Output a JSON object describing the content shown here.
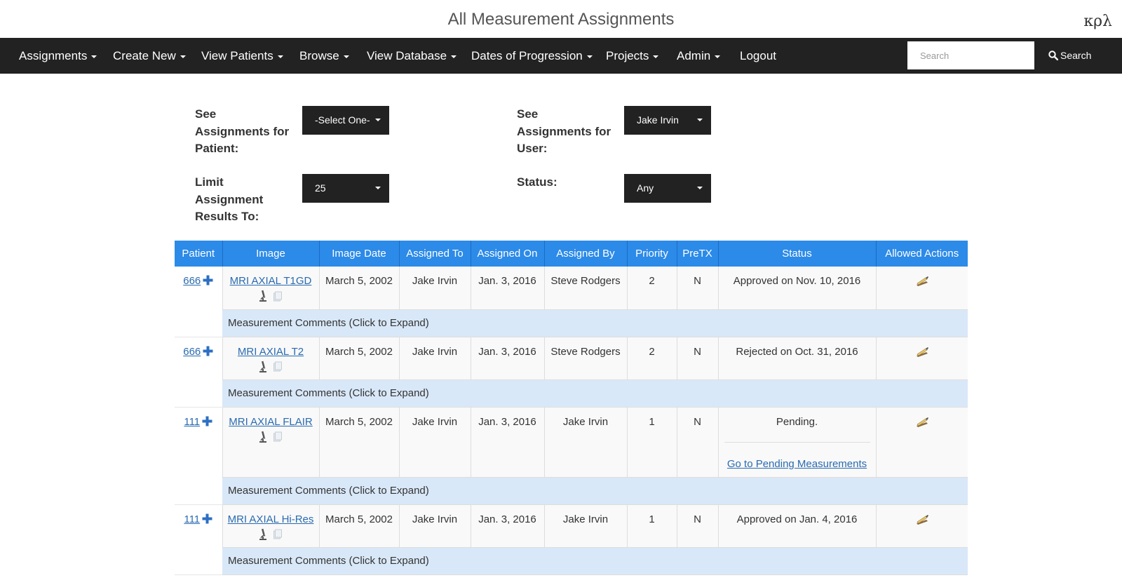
{
  "header": {
    "title": "All Measurement Assignments",
    "brand": "κρλ"
  },
  "nav": {
    "items": [
      {
        "label": "Assignments",
        "dropdown": true
      },
      {
        "label": "Create New",
        "dropdown": true
      },
      {
        "label": "View Patients",
        "dropdown": true
      },
      {
        "label": "Browse",
        "dropdown": true
      },
      {
        "label": "View Database",
        "dropdown": true
      },
      {
        "label": "Dates of Progression",
        "dropdown": true
      },
      {
        "label": "Projects",
        "dropdown": true
      },
      {
        "label": "Admin",
        "dropdown": true
      },
      {
        "label": "Logout",
        "dropdown": false
      }
    ],
    "search_placeholder": "Search",
    "search_button": "Search"
  },
  "filters": {
    "patient_label": [
      "See",
      "Assignments for",
      "Patient:"
    ],
    "patient_value": "-Select One-",
    "user_label": [
      "See",
      "Assignments for",
      "User:"
    ],
    "user_value": "Jake Irvin",
    "limit_label": [
      "Limit",
      "Assignment",
      "Results To:"
    ],
    "limit_value": "25",
    "status_label": "Status:",
    "status_value": "Any"
  },
  "table": {
    "columns": [
      "Patient",
      "Image",
      "Image Date",
      "Assigned To",
      "Assigned On",
      "Assigned By",
      "Priority",
      "PreTX",
      "Status",
      "Allowed Actions"
    ],
    "comments_label": "Measurement Comments (Click to Expand)",
    "rows": [
      {
        "patient": "666",
        "image": "MRI AXIAL T1GD",
        "image_date": "March 5, 2002",
        "assigned_to": "Jake Irvin",
        "assigned_on": "Jan. 3, 2016",
        "assigned_by": "Steve Rodgers",
        "priority": "2",
        "pretx": "N",
        "status": "Approved on Nov. 10, 2016"
      },
      {
        "patient": "666",
        "image": "MRI AXIAL T2",
        "image_date": "March 5, 2002",
        "assigned_to": "Jake Irvin",
        "assigned_on": "Jan. 3, 2016",
        "assigned_by": "Steve Rodgers",
        "priority": "2",
        "pretx": "N",
        "status": "Rejected on Oct. 31, 2016"
      },
      {
        "patient": "111",
        "image": "MRI AXIAL FLAIR",
        "image_date": "March 5, 2002",
        "assigned_to": "Jake Irvin",
        "assigned_on": "Jan. 3, 2016",
        "assigned_by": "Jake Irvin",
        "priority": "1",
        "pretx": "N",
        "status": "Pending.",
        "status_link": "Go to Pending Measurements"
      },
      {
        "patient": "111",
        "image": "MRI AXIAL Hi-Res",
        "image_date": "March 5, 2002",
        "assigned_to": "Jake Irvin",
        "assigned_on": "Jan. 3, 2016",
        "assigned_by": "Jake Irvin",
        "priority": "1",
        "pretx": "N",
        "status": "Approved on Jan. 4, 2016"
      }
    ]
  },
  "colors": {
    "navbar": "#222222",
    "table_header": "#2c8ae8",
    "comments_row": "#d9e8f8",
    "link": "#2a6bb0"
  }
}
